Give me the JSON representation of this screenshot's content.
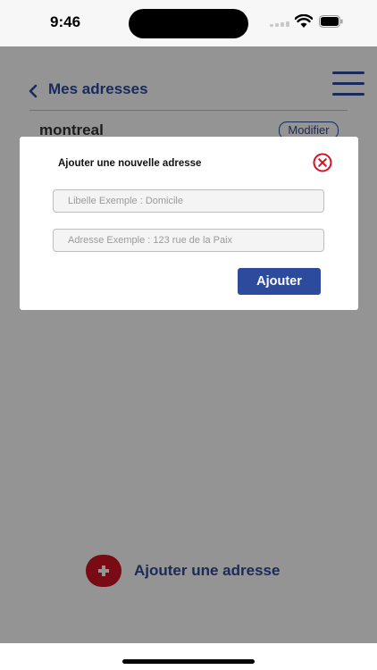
{
  "status_bar": {
    "time": "9:46",
    "icons": [
      "signal-icon",
      "wifi-icon",
      "battery-icon"
    ]
  },
  "header": {
    "back_icon": "chevron-left-icon",
    "title": "Mes adresses",
    "menu_icon": "hamburger-menu-icon"
  },
  "addresses": [
    {
      "name": "montreal",
      "modify_label": "Modifier"
    }
  ],
  "add_address": {
    "icon": "plus-icon",
    "label": "Ajouter une adresse"
  },
  "modal": {
    "title": "Ajouter une nouvelle adresse",
    "close_icon": "close-circle-icon",
    "label_input": {
      "value": "",
      "placeholder": "Libelle Exemple : Domicile"
    },
    "address_input": {
      "value": "",
      "placeholder": "Adresse Exemple : 123 rue de la Paix"
    },
    "submit_label": "Ajouter"
  },
  "colors": {
    "brand_blue": "#2d4b9c",
    "accent_red": "#d01424",
    "overlay": "rgba(0,0,0,0.42)"
  }
}
